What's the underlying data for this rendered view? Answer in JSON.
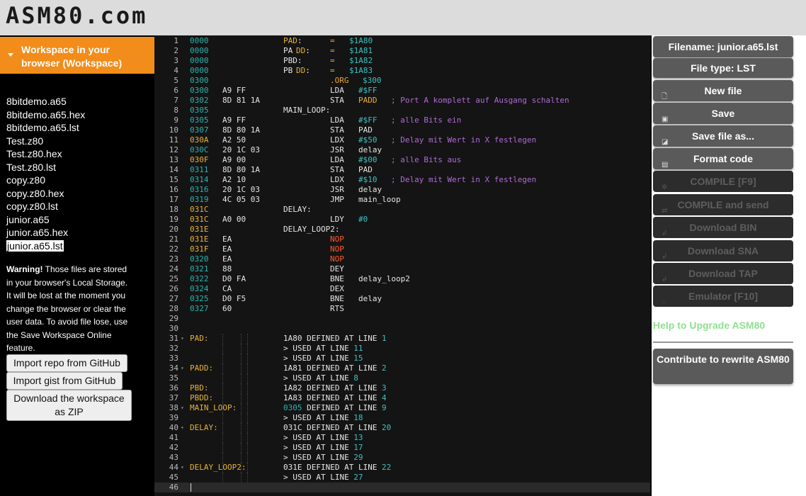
{
  "app": {
    "logo": "ASM80.com"
  },
  "sidebar": {
    "workspace_title": "Workspace in your browser (Workspace)",
    "files": [
      "8bitdemo.a65",
      "8bitdemo.a65.hex",
      "8bitdemo.a65.lst",
      "Test.z80",
      "Test.z80.hex",
      "Test.z80.lst",
      "copy.z80",
      "copy.z80.hex",
      "copy.z80.lst",
      "junior.a65",
      "junior.a65.hex",
      "junior.a65.lst"
    ],
    "selected_file": "junior.a65.lst",
    "warning_bold": "Warning!",
    "warning_text": " Those files are stored in your browser's Local Storage. It will be lost at the moment you change the browser or clear the user data. To avoid file lose, use the Save Workspace Online feature.",
    "buttons": {
      "import_repo": "Import repo from GitHub",
      "import_gist": "Import gist from GitHub",
      "download_zip": "Download the workspace as ZIP"
    }
  },
  "editor": {
    "current_line": 46,
    "lines": [
      [
        [
          "0000",
          "a"
        ],
        [
          "PAD",
          "y",
          "yl"
        ],
        [
          ":",
          "w"
        ],
        [
          "=",
          "o",
          "eq"
        ],
        [
          "$1A80",
          "c",
          "v"
        ]
      ],
      [
        [
          "0000",
          "a"
        ],
        [
          "PA",
          "w",
          "yl"
        ],
        [
          "DD",
          "y",
          "yl2"
        ],
        [
          ":",
          "w"
        ],
        [
          "=",
          "o",
          "eq"
        ],
        [
          "$1A81",
          "c",
          "v"
        ]
      ],
      [
        [
          "0000",
          "a"
        ],
        [
          "PBD:",
          "w",
          "yl"
        ],
        [
          "=",
          "o",
          "eq"
        ],
        [
          "$1A82",
          "c",
          "v"
        ]
      ],
      [
        [
          "0000",
          "a"
        ],
        [
          "PB",
          "w",
          "yl"
        ],
        [
          "DD",
          "y",
          "yl2"
        ],
        [
          ":",
          "w"
        ],
        [
          "=",
          "o",
          "eq"
        ],
        [
          "$1A83",
          "c",
          "v"
        ]
      ],
      [
        [
          "0300",
          "a"
        ],
        [
          ".ORG",
          "o",
          "op"
        ],
        [
          "$300",
          "c",
          "v2"
        ]
      ],
      [
        [
          "0300",
          "a"
        ],
        [
          "A9 FF",
          "w",
          "b"
        ],
        [
          "LDA",
          "w",
          "op"
        ],
        [
          "#$FF",
          "c",
          "arg"
        ]
      ],
      [
        [
          "0302",
          "a"
        ],
        [
          "8D 81 1A",
          "w",
          "b"
        ],
        [
          "STA",
          "w",
          "op"
        ],
        [
          "PADD",
          "y",
          "arg"
        ],
        [
          "; Port A komplett auf Ausgang schalten",
          "m",
          "cm"
        ]
      ],
      [
        [
          "0305",
          "a"
        ],
        [
          "MAIN_LOOP:",
          "w",
          "yl"
        ]
      ],
      [
        [
          "0305",
          "a"
        ],
        [
          "A9 FF",
          "w",
          "b"
        ],
        [
          "LDA",
          "w",
          "op"
        ],
        [
          "#$FF",
          "c",
          "arg"
        ],
        [
          "; alle Bits ein",
          "m",
          "cm"
        ]
      ],
      [
        [
          "0307",
          "a"
        ],
        [
          "8D 80 1A",
          "w",
          "b"
        ],
        [
          "STA",
          "w",
          "op"
        ],
        [
          "PAD",
          "w",
          "arg"
        ]
      ],
      [
        [
          "030A",
          "y"
        ],
        [
          "A2 50",
          "w",
          "b"
        ],
        [
          "LDX",
          "w",
          "op"
        ],
        [
          "#$50",
          "c",
          "arg"
        ],
        [
          "; Delay mit Wert in X festlegen",
          "m",
          "cm"
        ]
      ],
      [
        [
          "030C",
          "a"
        ],
        [
          "20 1C 03",
          "w",
          "b"
        ],
        [
          "JSR",
          "w",
          "op"
        ],
        [
          "delay",
          "w",
          "arg"
        ]
      ],
      [
        [
          "030F",
          "y"
        ],
        [
          "A9 00",
          "w",
          "b"
        ],
        [
          "LDA",
          "w",
          "op"
        ],
        [
          "#$00",
          "c",
          "arg"
        ],
        [
          "; alle Bits aus",
          "m",
          "cm"
        ]
      ],
      [
        [
          "0311",
          "a"
        ],
        [
          "8D 80 1A",
          "w",
          "b"
        ],
        [
          "STA",
          "w",
          "op"
        ],
        [
          "PAD",
          "w",
          "arg"
        ]
      ],
      [
        [
          "0314",
          "a"
        ],
        [
          "A2 10",
          "w",
          "b"
        ],
        [
          "LDX",
          "w",
          "op"
        ],
        [
          "#$10",
          "c",
          "arg"
        ],
        [
          "; Delay mit Wert in X festlegen",
          "m",
          "cm"
        ]
      ],
      [
        [
          "0316",
          "a"
        ],
        [
          "20 1C 03",
          "w",
          "b"
        ],
        [
          "JSR",
          "w",
          "op"
        ],
        [
          "delay",
          "w",
          "arg"
        ]
      ],
      [
        [
          "0319",
          "a"
        ],
        [
          "4C 05 03",
          "w",
          "b"
        ],
        [
          "JMP",
          "w",
          "op"
        ],
        [
          "main_loop",
          "w",
          "arg"
        ]
      ],
      [
        [
          "031C",
          "y"
        ],
        [
          "DELAY:",
          "w",
          "yl"
        ]
      ],
      [
        [
          "031C",
          "y"
        ],
        [
          "A0 00",
          "w",
          "b"
        ],
        [
          "LDY",
          "w",
          "op"
        ],
        [
          "#0",
          "c",
          "arg"
        ]
      ],
      [
        [
          "031E",
          "y"
        ],
        [
          "DELAY_LOOP2:",
          "w",
          "yl"
        ]
      ],
      [
        [
          "031E",
          "y"
        ],
        [
          "EA",
          "w",
          "b"
        ],
        [
          "NOP",
          "r",
          "op"
        ]
      ],
      [
        [
          "031F",
          "y"
        ],
        [
          "EA",
          "w",
          "b"
        ],
        [
          "NOP",
          "r",
          "op"
        ]
      ],
      [
        [
          "0320",
          "a"
        ],
        [
          "EA",
          "w",
          "b"
        ],
        [
          "NOP",
          "r",
          "op"
        ]
      ],
      [
        [
          "0321",
          "a"
        ],
        [
          "88",
          "w",
          "b"
        ],
        [
          "DEY",
          "w",
          "op"
        ]
      ],
      [
        [
          "0322",
          "a"
        ],
        [
          "D0 FA",
          "w",
          "b"
        ],
        [
          "BNE",
          "w",
          "op"
        ],
        [
          "delay_loop2",
          "w",
          "arg"
        ]
      ],
      [
        [
          "0324",
          "a"
        ],
        [
          "CA",
          "w",
          "b"
        ],
        [
          "DEX",
          "w",
          "op"
        ]
      ],
      [
        [
          "0325",
          "a"
        ],
        [
          "D0 F5",
          "w",
          "b"
        ],
        [
          "BNE",
          "w",
          "op"
        ],
        [
          "delay",
          "w",
          "arg"
        ]
      ],
      [
        [
          "0327",
          "a"
        ],
        [
          "60",
          "w",
          "b"
        ],
        [
          "RTS",
          "w",
          "op"
        ]
      ],
      [],
      [],
      [
        [
          "PAD:",
          "y",
          "sym"
        ],
        [
          "1A80 DEFINED AT LINE ",
          "w",
          "def"
        ],
        [
          "1",
          "c"
        ]
      ],
      [
        [
          "> USED AT LINE ",
          "w",
          "def"
        ],
        [
          "11",
          "c"
        ]
      ],
      [
        [
          "> USED AT LINE ",
          "w",
          "def"
        ],
        [
          "15",
          "c"
        ]
      ],
      [
        [
          "PADD:",
          "y",
          "sym"
        ],
        [
          "1A81 DEFINED AT LINE ",
          "w",
          "def"
        ],
        [
          "2",
          "c"
        ]
      ],
      [
        [
          "> USED AT LINE ",
          "w",
          "def"
        ],
        [
          "8",
          "c"
        ]
      ],
      [
        [
          "PBD:",
          "y",
          "sym"
        ],
        [
          "1A82 DEFINED AT LINE ",
          "w",
          "def"
        ],
        [
          "3",
          "c"
        ]
      ],
      [
        [
          "PBDD:",
          "y",
          "sym"
        ],
        [
          "1A83 DEFINED AT LINE ",
          "w",
          "def"
        ],
        [
          "4",
          "c"
        ]
      ],
      [
        [
          "MAIN_LOOP:",
          "y",
          "sym"
        ],
        [
          "0305",
          "a",
          "def"
        ],
        [
          " DEFINED AT LINE ",
          "w"
        ],
        [
          "9",
          "c"
        ]
      ],
      [
        [
          "> USED AT LINE ",
          "w",
          "def"
        ],
        [
          "18",
          "c"
        ]
      ],
      [
        [
          "DELAY:",
          "y",
          "sym"
        ],
        [
          "031C DEFINED AT LINE ",
          "w",
          "def"
        ],
        [
          "20",
          "c"
        ]
      ],
      [
        [
          "> USED AT LINE ",
          "w",
          "def"
        ],
        [
          "13",
          "c"
        ]
      ],
      [
        [
          "> USED AT LINE ",
          "w",
          "def"
        ],
        [
          "17",
          "c"
        ]
      ],
      [
        [
          "> USED AT LINE ",
          "w",
          "def"
        ],
        [
          "29",
          "c"
        ]
      ],
      [
        [
          "DELAY_LOOP2:",
          "y",
          "sym"
        ],
        [
          "031E DEFINED AT LINE ",
          "w",
          "def"
        ],
        [
          "22",
          "c"
        ]
      ],
      [
        [
          "> USED AT LINE ",
          "w",
          "def"
        ],
        [
          "27",
          "c"
        ]
      ],
      []
    ],
    "fold_lines": [
      31,
      34,
      38,
      40,
      44
    ]
  },
  "right_panel": {
    "filename": "Filename: junior.a65.lst",
    "filetype": "File type: LST",
    "buttons": [
      {
        "label": "New file",
        "icon": "file-icon",
        "glyph": "🗋",
        "enabled": true
      },
      {
        "label": "Save",
        "icon": "save-icon",
        "glyph": "▣",
        "enabled": true
      },
      {
        "label": "Save file as...",
        "icon": "save-as-icon",
        "glyph": "◪",
        "enabled": true
      },
      {
        "label": "Format code",
        "icon": "clipboard-icon",
        "glyph": "▤",
        "enabled": true
      },
      {
        "label": "COMPILE [F9]",
        "icon": "gear-icon",
        "glyph": "✲",
        "enabled": false
      },
      {
        "label": "COMPILE and send",
        "icon": "send-icon",
        "glyph": "⇄",
        "enabled": false
      },
      {
        "label": "Download BIN",
        "icon": "download-icon",
        "glyph": "↲",
        "enabled": false
      },
      {
        "label": "Download SNA",
        "icon": "download-icon",
        "glyph": "↲",
        "enabled": false
      },
      {
        "label": "Download TAP",
        "icon": "download-icon",
        "glyph": "↲",
        "enabled": false
      },
      {
        "label": "Emulator [F10]",
        "icon": "bulb-icon",
        "glyph": "◌",
        "enabled": false
      }
    ],
    "help_link": "Help to Upgrade ASM80",
    "contribute": "Contribute to rewrite ASM80"
  },
  "colors": {
    "orange": "#f28c1a",
    "code_addr": "#2bb3b3",
    "code_yellow": "#e8b23a",
    "code_white": "#e6e6e6",
    "code_magenta": "#b16ad6",
    "code_red": "#ff5a2a",
    "code_orange": "#e9a23b",
    "code_cyan": "#3fc0c0",
    "help_green": "#8fe08f"
  }
}
